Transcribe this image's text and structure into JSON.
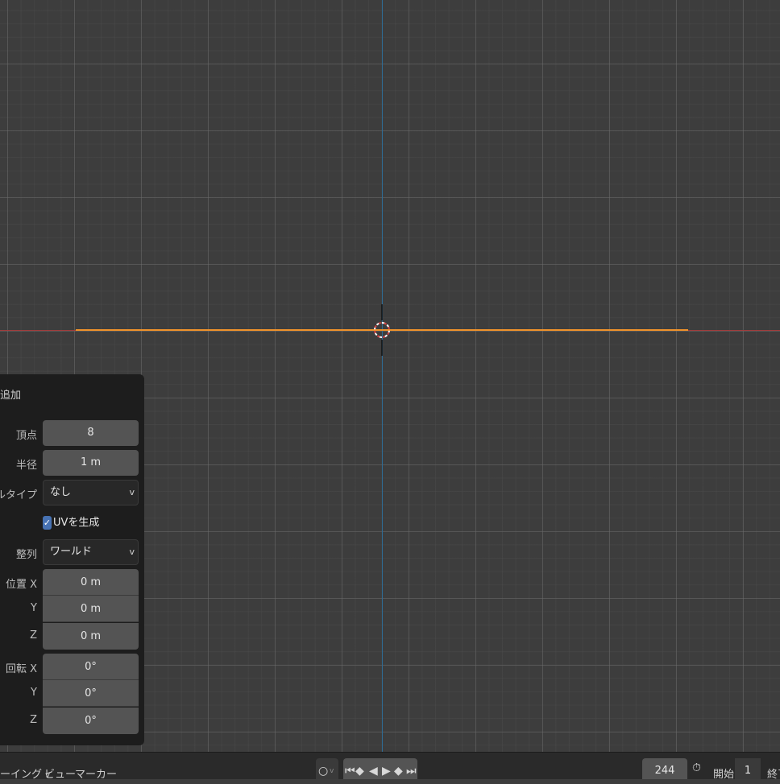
{
  "operator_panel": {
    "title": "追加",
    "vertices": {
      "label": "頂点",
      "value": "8"
    },
    "radius": {
      "label": "半径",
      "value": "1 m"
    },
    "fill_type": {
      "label": "フィルタイプ",
      "value": "なし"
    },
    "generate_uvs": {
      "label": "UVを生成",
      "checked": true
    },
    "align": {
      "label": "整列",
      "value": "ワールド"
    },
    "location": {
      "label_x": "位置 X",
      "label_y": "Y",
      "label_z": "Z",
      "x": "0 m",
      "y": "0 m",
      "z": "0 m"
    },
    "rotation": {
      "label_x": "回転 X",
      "label_y": "Y",
      "label_z": "Z",
      "x": "0°",
      "y": "0°",
      "z": "0°"
    }
  },
  "timeline": {
    "menu_playback": "ーイング",
    "menu_view": "ビュー",
    "menu_marker": "マーカー",
    "current_frame": "244",
    "start_label": "開始",
    "start_value": "1",
    "end_label": "終了"
  },
  "colors": {
    "accent": "#4772b3",
    "selected_edge": "#f0932b",
    "axis_x": "#a03c3c",
    "axis_y": "#2f6b93"
  }
}
